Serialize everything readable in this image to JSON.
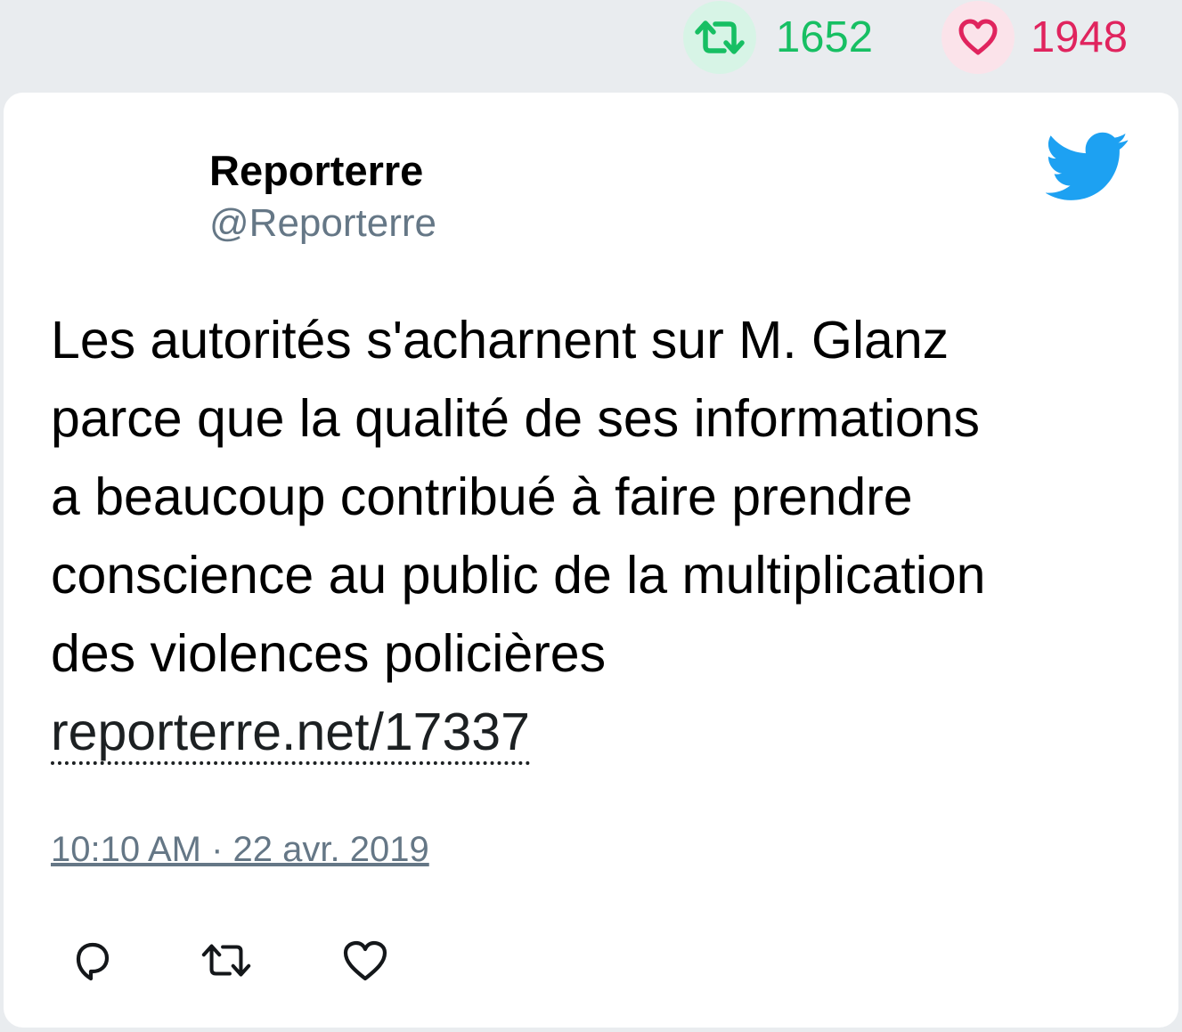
{
  "stats": {
    "retweets": "1652",
    "likes": "1948",
    "retweet_icon": "retweet-icon",
    "like_icon": "heart-icon",
    "retweet_color": "#17bf63",
    "like_color": "#e0245e"
  },
  "tweet": {
    "author_name": "Reporterre",
    "author_handle": "@Reporterre",
    "text_lines": [
      "Les autorités s'acharnent sur M. Glanz",
      "parce que la qualité de ses informations",
      "a beaucoup contribué à faire prendre",
      "conscience au public de la multiplication",
      "des violences policières"
    ],
    "link": "reporterre.net/17337",
    "timestamp": "10:10 AM · 22 avr. 2019",
    "brand_icon": "twitter-bird-icon",
    "brand_color": "#1da1f2"
  },
  "actions": {
    "reply_icon": "reply-icon",
    "retweet_icon": "retweet-icon",
    "like_icon": "heart-icon"
  }
}
